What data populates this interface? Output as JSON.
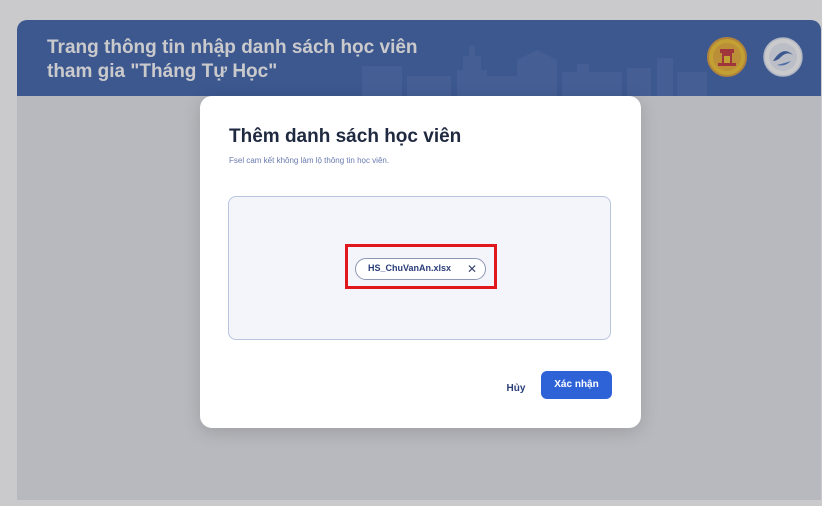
{
  "header": {
    "title_line1": "Trang thông tin nhập danh sách học viên",
    "title_line2": "tham gia \"Tháng Tự Học\""
  },
  "modal": {
    "title": "Thêm danh sách học viên",
    "subtitle": "Fsel cam kết không làm lộ thông tin học viên.",
    "file": {
      "name": "HS_ChuVanAn.xlsx",
      "remove_symbol": "✕"
    },
    "cancel_label": "Hủy",
    "confirm_label": "Xác nhận"
  },
  "colors": {
    "header_bg": "#2f57a6",
    "primary": "#2e63d8",
    "highlight": "#e0171d"
  },
  "icons": [
    "close-icon",
    "hanoi-emblem-logo",
    "program-logo"
  ]
}
